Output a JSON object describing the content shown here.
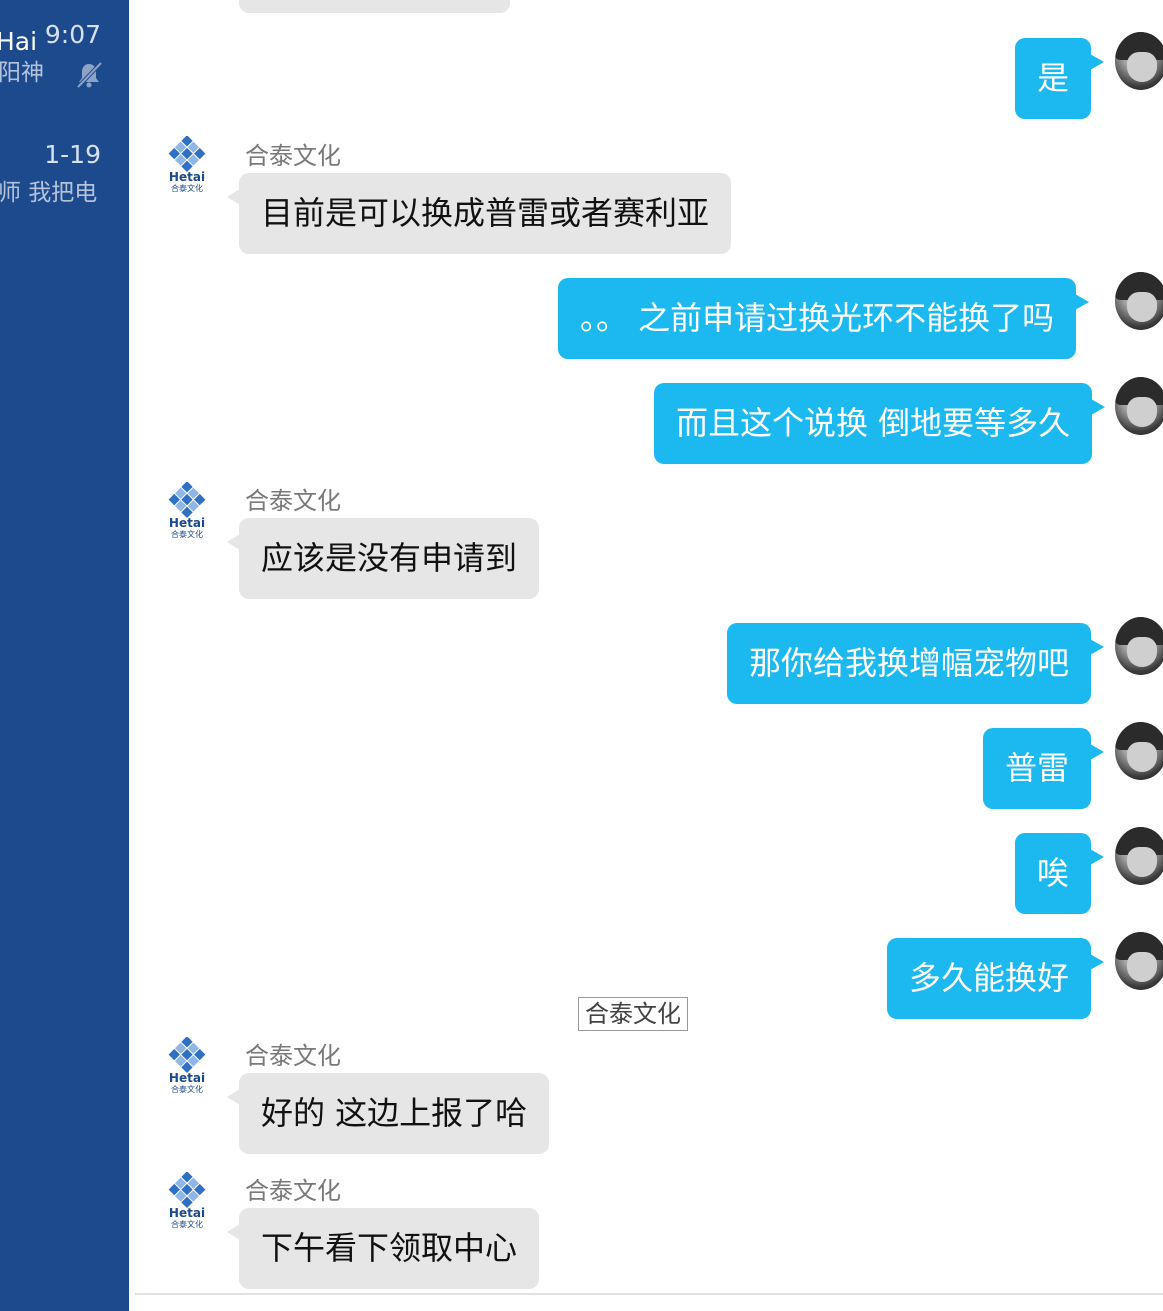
{
  "sidebar": {
    "conversations": [
      {
        "name": "Hai",
        "time": "9:07",
        "preview": "阳神",
        "muted": true
      },
      {
        "time": "1-19",
        "preview": "师 我把电"
      }
    ]
  },
  "chat": {
    "center_label": "合泰文化",
    "messages": [
      {
        "direction": "out",
        "text": "是"
      },
      {
        "direction": "in",
        "sender": "合泰文化",
        "text": "目前是可以换成普雷或者赛利亚"
      },
      {
        "direction": "out",
        "text": "。。 之前申请过换光环不能换了吗"
      },
      {
        "direction": "out",
        "text": "而且这个说换 倒地要等多久"
      },
      {
        "direction": "in",
        "sender": "合泰文化",
        "text": "应该是没有申请到"
      },
      {
        "direction": "out",
        "text": "那你给我换增幅宠物吧"
      },
      {
        "direction": "out",
        "text": "普雷"
      },
      {
        "direction": "out",
        "text": "唉"
      },
      {
        "direction": "out",
        "text": "多久能换好"
      },
      {
        "direction": "in",
        "sender": "合泰文化",
        "text": "好的 这边上报了哈"
      },
      {
        "direction": "in",
        "sender": "合泰文化",
        "text": "下午看下领取中心"
      }
    ]
  },
  "logo": {
    "brand": "Hetai",
    "subtitle": "合泰文化"
  },
  "colors": {
    "sidebar": "#1d4a8c",
    "outgoing_bubble": "#1cb9f0",
    "incoming_bubble": "#e6e6e6"
  }
}
